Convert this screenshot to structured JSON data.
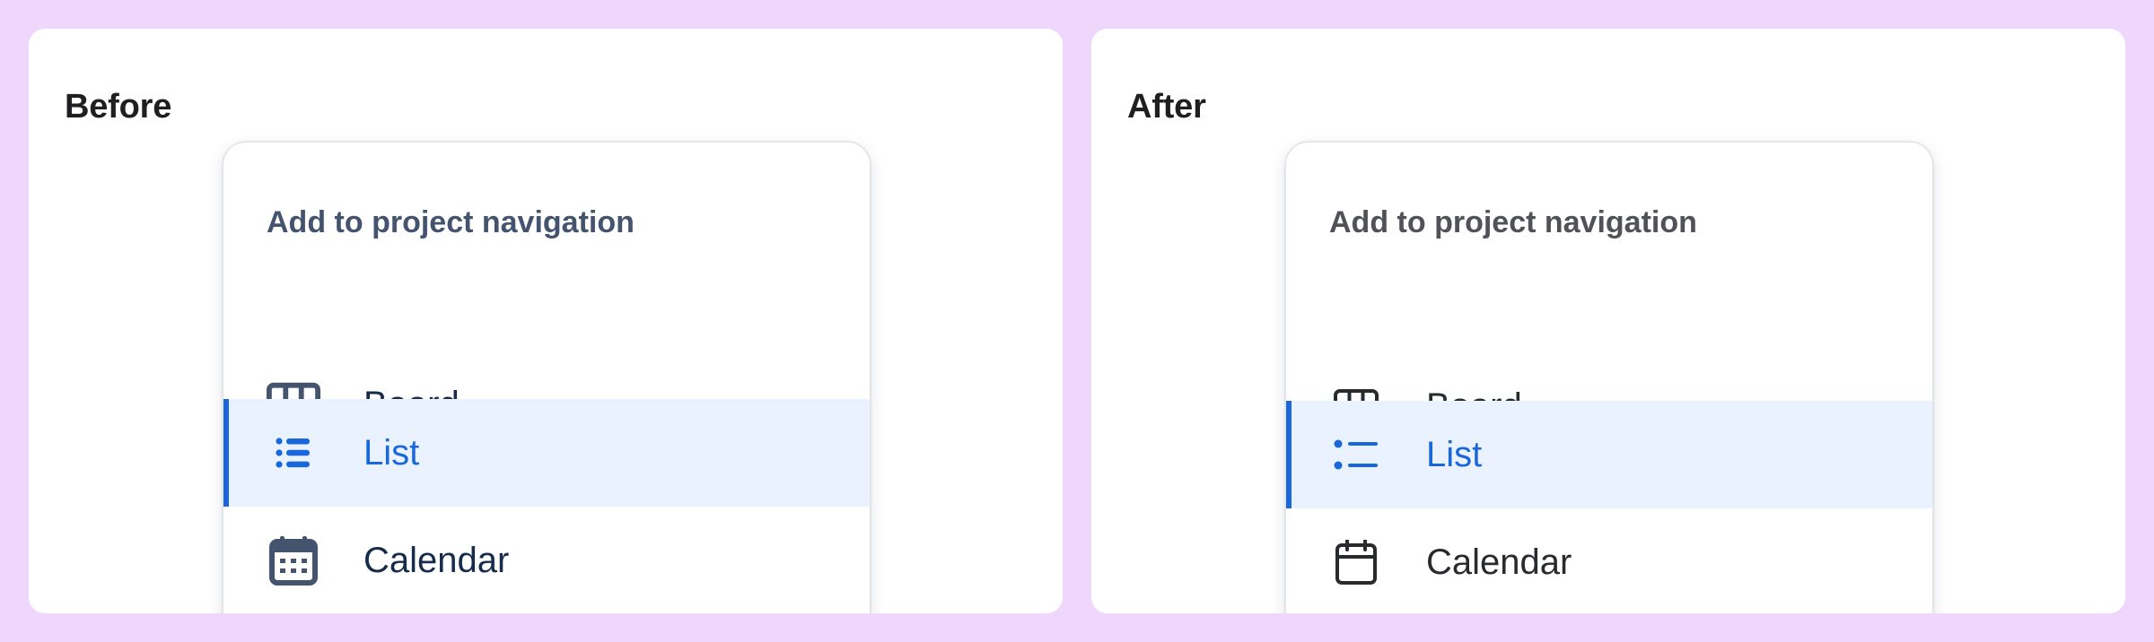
{
  "panels": {
    "before": {
      "title": "Before",
      "menu": {
        "heading": "Add to project navigation",
        "items": [
          {
            "label": "Board",
            "icon": "board-icon",
            "selected": false
          },
          {
            "label": "List",
            "icon": "list-icon",
            "selected": true
          },
          {
            "label": "Calendar",
            "icon": "calendar-icon",
            "selected": false
          }
        ]
      }
    },
    "after": {
      "title": "After",
      "menu": {
        "heading": "Add to project navigation",
        "items": [
          {
            "label": "Board",
            "icon": "board-icon",
            "selected": false
          },
          {
            "label": "List",
            "icon": "list-icon",
            "selected": true
          },
          {
            "label": "Calendar",
            "icon": "calendar-icon",
            "selected": false
          }
        ]
      }
    }
  },
  "colors": {
    "background": "#efd7fc",
    "selected_accent": "#1868db",
    "selected_background": "#e9f2fe",
    "before_icon": "#44546f",
    "after_icon": "#292a2e"
  }
}
